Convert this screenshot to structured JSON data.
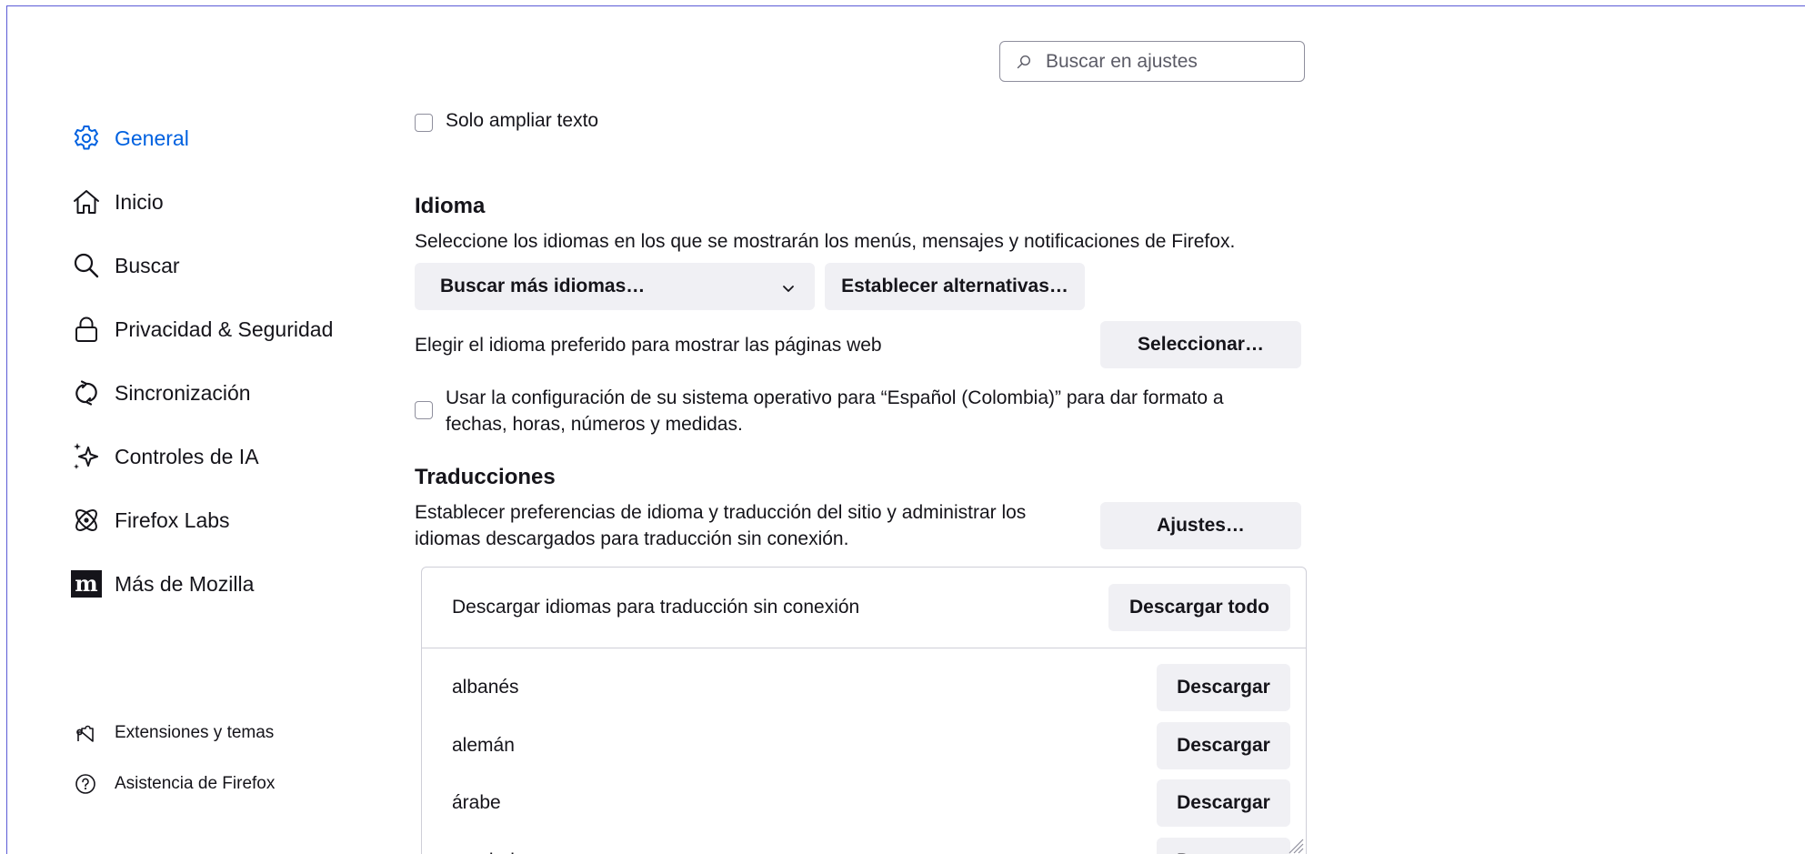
{
  "search": {
    "placeholder": "Buscar en ajustes"
  },
  "sidebar": {
    "items": [
      {
        "label": "General",
        "icon": "gear-icon",
        "active": true
      },
      {
        "label": "Inicio",
        "icon": "home-icon"
      },
      {
        "label": "Buscar",
        "icon": "search-icon"
      },
      {
        "label": "Privacidad & Seguridad",
        "icon": "lock-icon"
      },
      {
        "label": "Sincronización",
        "icon": "sync-icon"
      },
      {
        "label": "Controles de IA",
        "icon": "sparkle-icon"
      },
      {
        "label": "Firefox Labs",
        "icon": "atom-icon"
      },
      {
        "label": "Más de Mozilla",
        "icon": "mozilla-icon"
      }
    ],
    "footer": [
      {
        "label": "Extensiones y temas",
        "icon": "puzzle-icon"
      },
      {
        "label": "Asistencia de Firefox",
        "icon": "help-icon"
      }
    ]
  },
  "zoom": {
    "text_only_label": "Solo ampliar texto"
  },
  "language": {
    "heading": "Idioma",
    "description": "Seleccione los idiomas en los que se mostrarán los menús, mensajes y notificaciones de Firefox.",
    "dropdown_value": "Buscar más idiomas…",
    "alternatives_button": "Establecer alternativas…",
    "web_pages_label": "Elegir el idioma preferido para mostrar las páginas web",
    "select_button": "Seleccionar…",
    "os_format_line1": "Usar la configuración de su sistema operativo para “Español (Colombia)” para dar formato a",
    "os_format_line2": "fechas, horas, números y medidas."
  },
  "translations": {
    "heading": "Traducciones",
    "description_line1": "Establecer preferencias de idioma y traducción del sitio y administrar los",
    "description_line2": "idiomas descargados para traducción sin conexión.",
    "settings_button": "Ajustes…",
    "download_header": "Descargar idiomas para traducción sin conexión",
    "download_all_button": "Descargar todo",
    "download_button": "Descargar",
    "languages": [
      "albanés",
      "alemán",
      "árabe",
      "azerbaiyano"
    ]
  },
  "colors": {
    "accent": "#0061e0",
    "frame": "#5b5bd6",
    "button_bg": "#f0f0f4"
  }
}
